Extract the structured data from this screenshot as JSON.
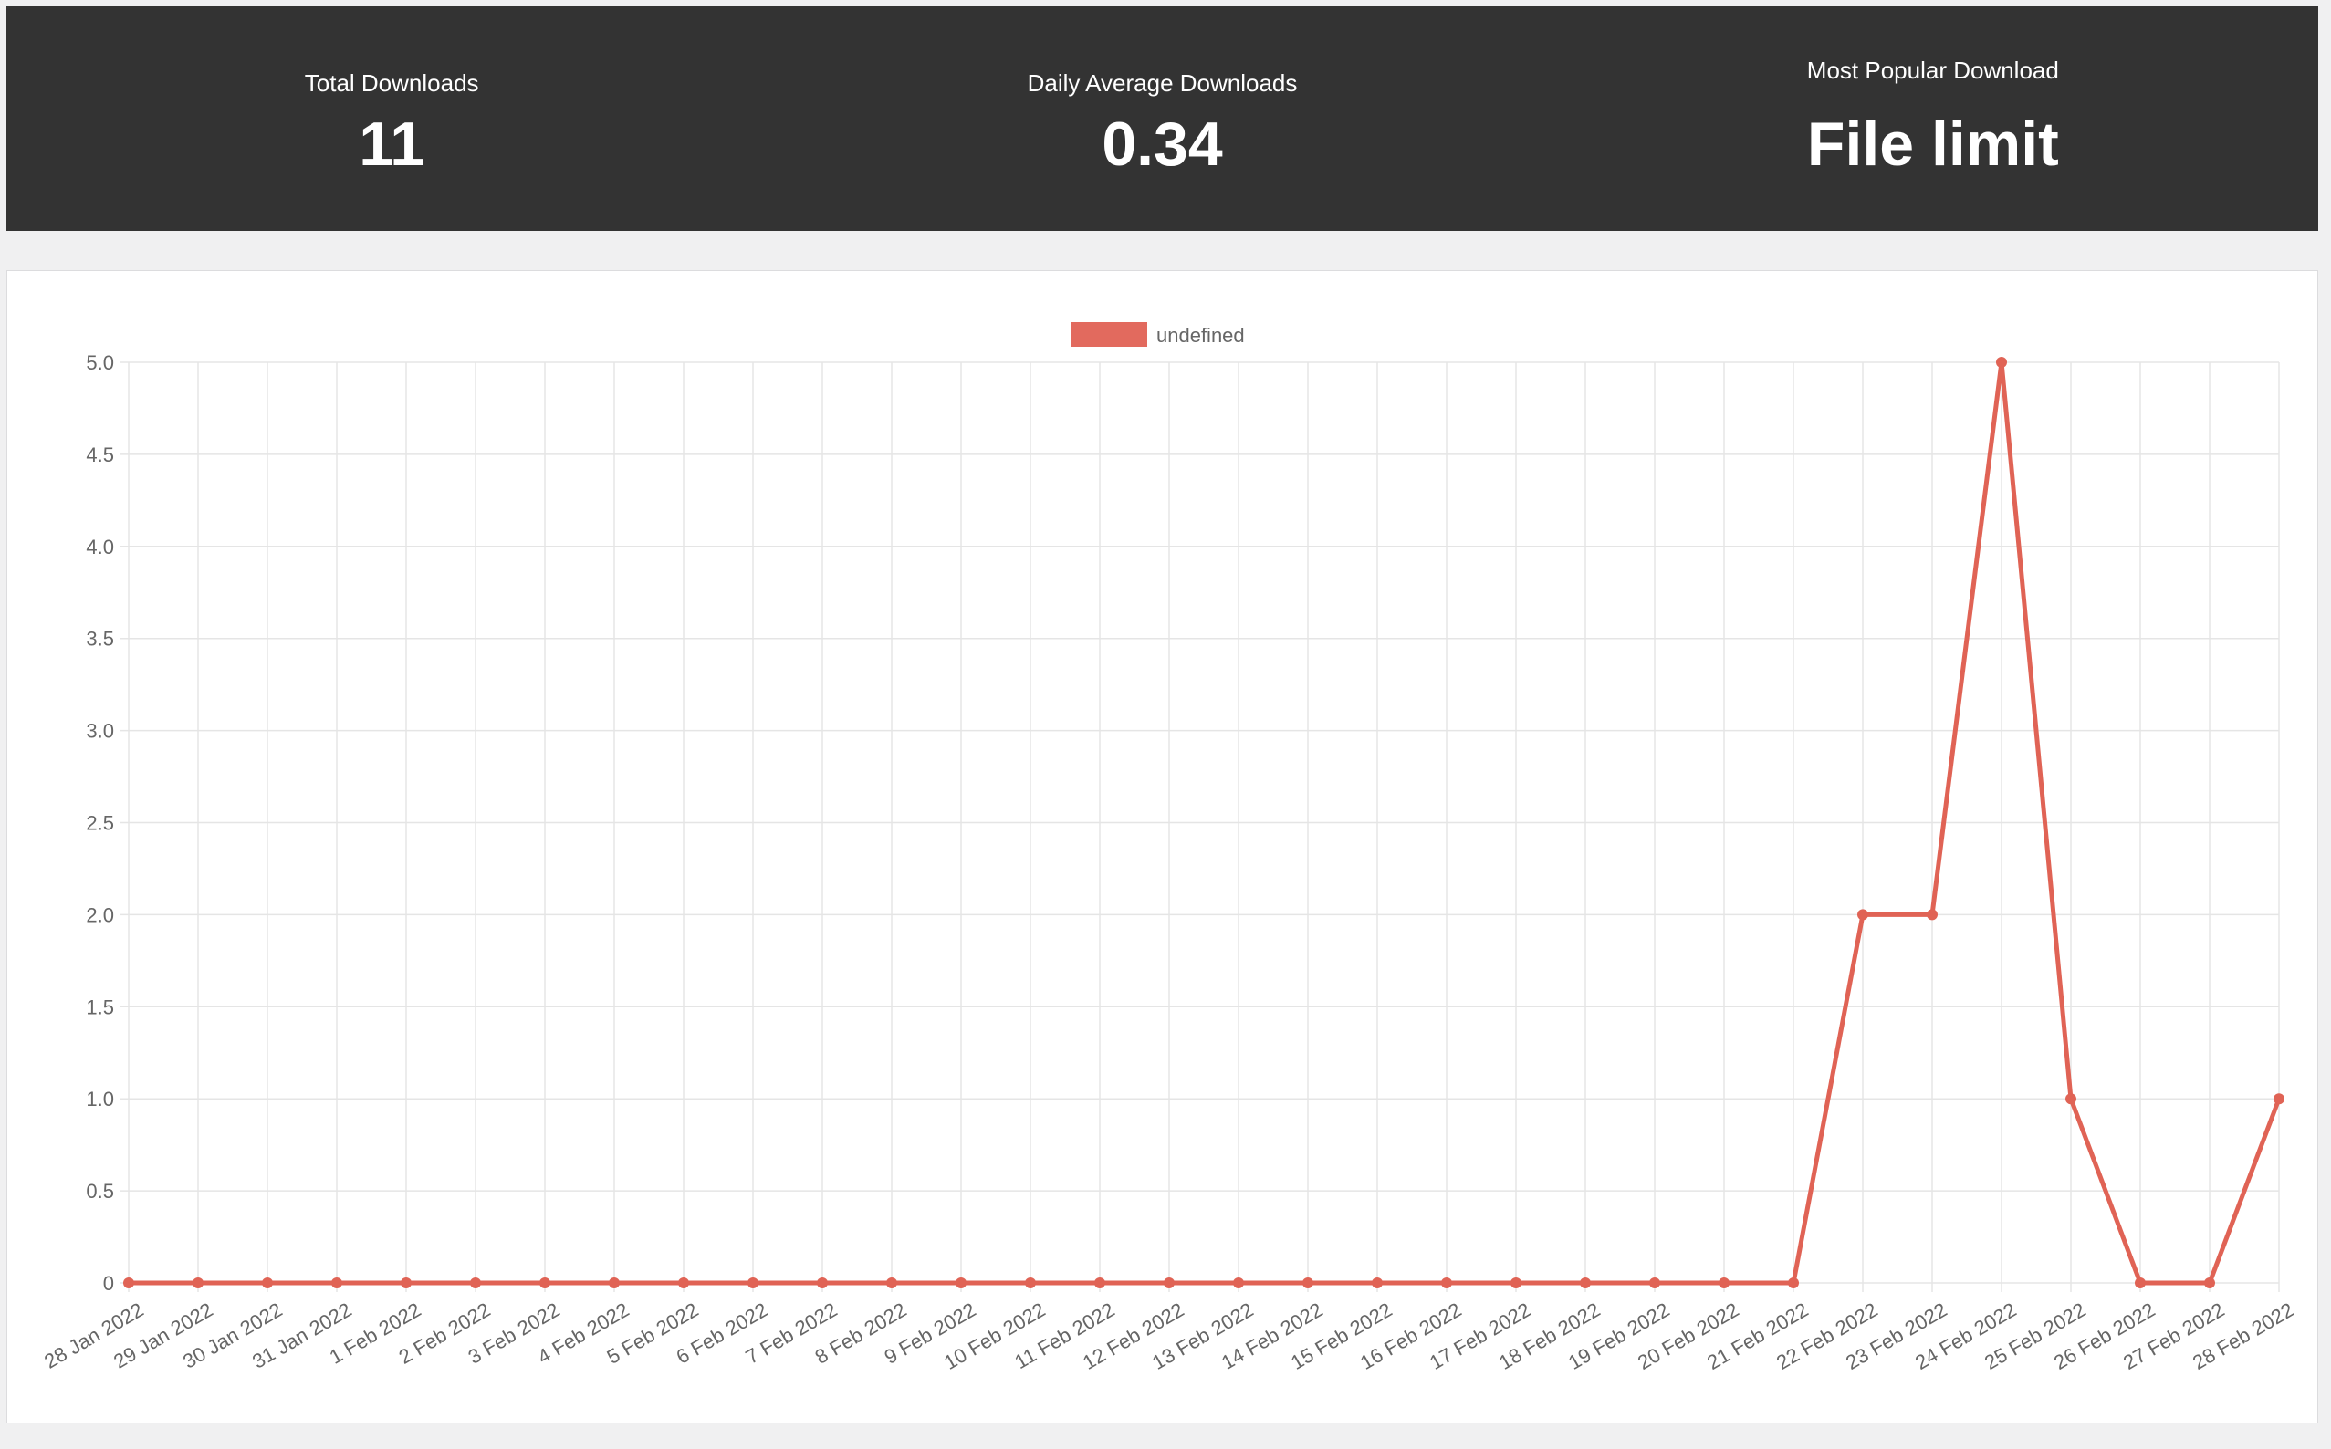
{
  "stats": {
    "total_label": "Total Downloads",
    "total_value": "11",
    "daily_label": "Daily Average Downloads",
    "daily_value": "0.34",
    "popular_label": "Most Popular Download",
    "popular_value": "File limit"
  },
  "colors": {
    "stats_background": "#333333",
    "series": "#e06355",
    "series_fill": "#e26a5e"
  },
  "chart_data": {
    "type": "line",
    "x": [
      "28 Jan 2022",
      "29 Jan 2022",
      "30 Jan 2022",
      "31 Jan 2022",
      "1 Feb 2022",
      "2 Feb 2022",
      "3 Feb 2022",
      "4 Feb 2022",
      "5 Feb 2022",
      "6 Feb 2022",
      "7 Feb 2022",
      "8 Feb 2022",
      "9 Feb 2022",
      "10 Feb 2022",
      "11 Feb 2022",
      "12 Feb 2022",
      "13 Feb 2022",
      "14 Feb 2022",
      "15 Feb 2022",
      "16 Feb 2022",
      "17 Feb 2022",
      "18 Feb 2022",
      "19 Feb 2022",
      "20 Feb 2022",
      "21 Feb 2022",
      "22 Feb 2022",
      "23 Feb 2022",
      "24 Feb 2022",
      "25 Feb 2022",
      "26 Feb 2022",
      "27 Feb 2022",
      "28 Feb 2022"
    ],
    "series": [
      {
        "name": "undefined",
        "values": [
          0,
          0,
          0,
          0,
          0,
          0,
          0,
          0,
          0,
          0,
          0,
          0,
          0,
          0,
          0,
          0,
          0,
          0,
          0,
          0,
          0,
          0,
          0,
          0,
          0,
          2,
          2,
          5,
          1,
          0,
          0,
          1
        ]
      }
    ],
    "y_ticks": [
      "0",
      "0.5",
      "1.0",
      "1.5",
      "2.0",
      "2.5",
      "3.0",
      "3.5",
      "4.0",
      "4.5",
      "5.0"
    ],
    "ylim": [
      0,
      5
    ],
    "grid": true,
    "legend_position": "top-center"
  }
}
